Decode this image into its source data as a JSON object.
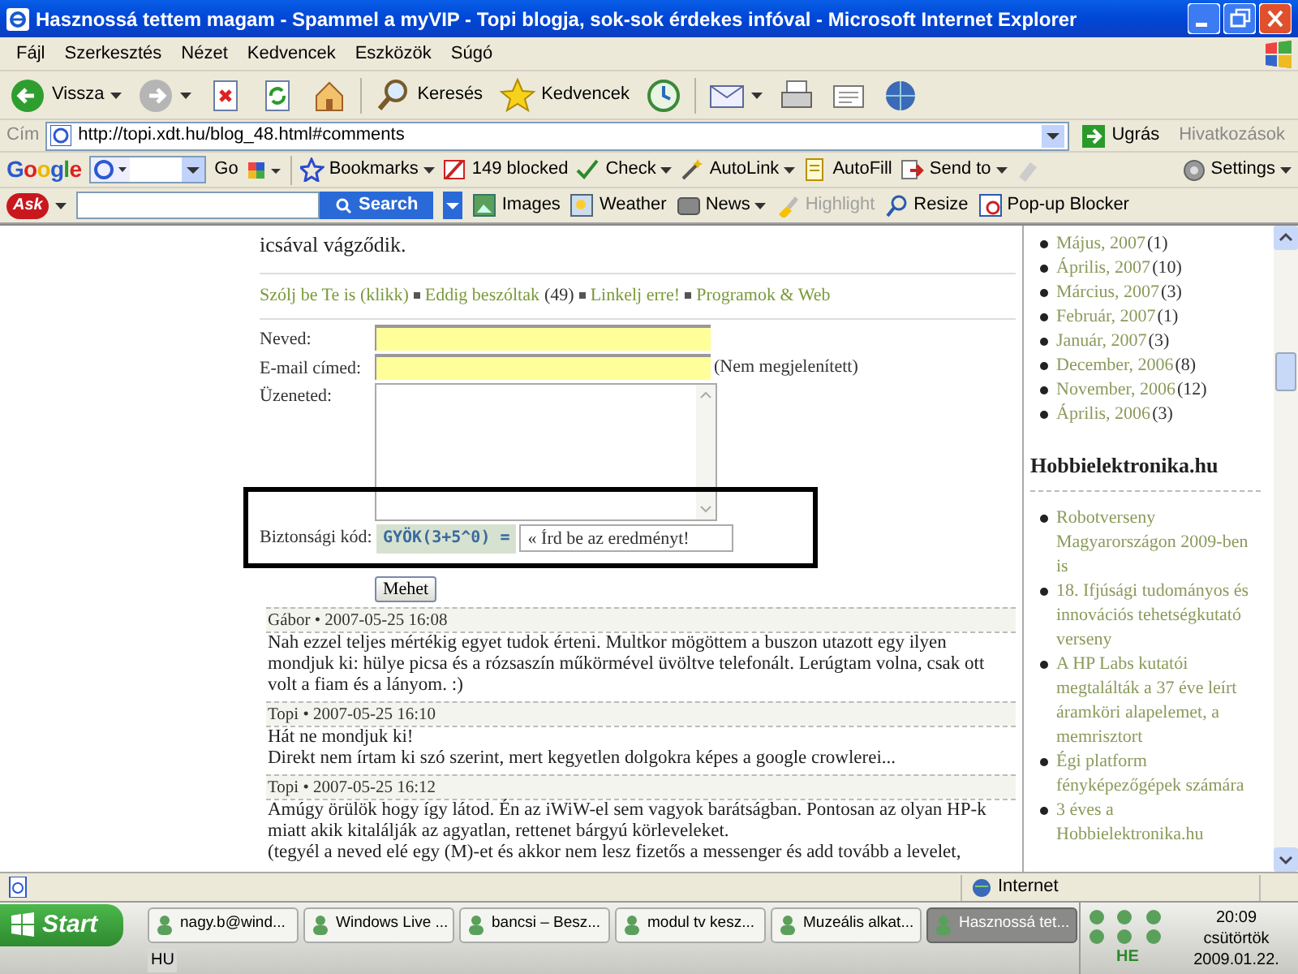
{
  "window": {
    "title": "Hasznossá tettem magam - Spammel a myVIP - Topi blogja, sok-sok érdekes infóval - Microsoft Internet Explorer"
  },
  "menu": [
    "Fájl",
    "Szerkesztés",
    "Nézet",
    "Kedvencek",
    "Eszközök",
    "Súgó"
  ],
  "toolbar": [
    {
      "kind": "back",
      "label": "Vissza"
    },
    {
      "kind": "forward"
    },
    {
      "kind": "stop"
    },
    {
      "kind": "refresh"
    },
    {
      "kind": "home"
    },
    {
      "kind": "search",
      "label": "Keresés"
    },
    {
      "kind": "favorites",
      "label": "Kedvencek"
    },
    {
      "kind": "history"
    },
    {
      "kind": "mail"
    },
    {
      "kind": "print"
    },
    {
      "kind": "edit"
    },
    {
      "kind": "globe"
    }
  ],
  "address": {
    "label": "Cím",
    "url": "http://topi.xdt.hu/blog_48.html#comments",
    "go": "Ugrás",
    "links": "Hivatkozások"
  },
  "google_bar": {
    "logo": "Google",
    "go": "Go",
    "items": [
      {
        "kind": "bookmarks",
        "label": "Bookmarks"
      },
      {
        "kind": "blocked",
        "label": "149 blocked"
      },
      {
        "kind": "check",
        "label": "Check"
      },
      {
        "kind": "autolink",
        "label": "AutoLink"
      },
      {
        "kind": "autofill",
        "label": "AutoFill"
      },
      {
        "kind": "sendto",
        "label": "Send to"
      }
    ],
    "settings": "Settings"
  },
  "ask_bar": {
    "logo": "Ask",
    "search": "Search",
    "items": [
      {
        "kind": "images",
        "label": "Images",
        "disabled": false
      },
      {
        "kind": "weather",
        "label": "Weather",
        "disabled": false
      },
      {
        "kind": "news",
        "label": "News",
        "disabled": false
      },
      {
        "kind": "highlight",
        "label": "Highlight",
        "disabled": true
      },
      {
        "kind": "resize",
        "label": "Resize",
        "disabled": false
      },
      {
        "kind": "popup",
        "label": "Pop-up Blocker",
        "disabled": false
      }
    ]
  },
  "article": {
    "tail": "icsával vágződik.",
    "links": [
      {
        "text": "Szólj be Te is (klikk)"
      },
      {
        "text": "Eddig beszóltak",
        "count": "(49)"
      },
      {
        "text": "Linkelj erre!"
      },
      {
        "text": "Programok & Web"
      }
    ]
  },
  "form": {
    "name_label": "Neved:",
    "email_label": "E-mail címed:",
    "email_note": "(Nem megjelenített)",
    "message_label": "Üzeneted:",
    "captcha_label": "Biztonsági kód:",
    "captcha": "GYÖK(3+5^0) =",
    "captcha_value": "« Írd be az eredményt!",
    "submit": "Mehet"
  },
  "comments": [
    {
      "header": "Gábor • 2007-05-25 16:08",
      "lines": [
        "Nah ezzel teljes mértékig egyet tudok érteni. Multkor mögöttem a buszon utazott egy ilyen mondjuk ki: hülye picsa és a rózsaszín műkörmével üvöltve telefonált. Lerúgtam volna, csak ott volt a fiam és a lányom. :)"
      ]
    },
    {
      "header": "Topi • 2007-05-25 16:10",
      "lines": [
        "Hát ne mondjuk ki!",
        "Direkt nem írtam ki szó szerint, mert kegyetlen dolgokra képes a google crowlerei..."
      ]
    },
    {
      "header": "Topi • 2007-05-25 16:12",
      "lines": [
        "Amúgy örülök hogy így látod. Én az iWiW-el sem vagyok barátságban. Pontosan az olyan HP-k miatt akik kitalálják az agyatlan, rettenet bárgyú körleveleket.",
        "(tegyél a neved elé egy (M)-et és akkor nem lesz fizetős a messenger és add tovább a levelet,"
      ]
    }
  ],
  "sidebar": {
    "archive": [
      {
        "text": "Május, 2007",
        "count": "(1)"
      },
      {
        "text": "Április, 2007",
        "count": "(10)"
      },
      {
        "text": "Március, 2007",
        "count": "(3)"
      },
      {
        "text": "Február, 2007",
        "count": "(1)"
      },
      {
        "text": "Január, 2007",
        "count": "(3)"
      },
      {
        "text": "December, 2006",
        "count": "(8)"
      },
      {
        "text": "November, 2006",
        "count": "(12)"
      },
      {
        "text": "Április, 2006",
        "count": "(3)"
      }
    ],
    "title": "Hobbielektronika.hu",
    "links": [
      "Robotverseny Magyarországon 2009-ben is",
      "18. Ifjúsági tudományos és innovációs tehetségkutató verseny",
      "A HP Labs kutatói megtalálták a 37 éve leírt áramköri alapelemet, a memrisztort",
      "Égi platform fényképezőgépek számára",
      "3 éves a Hobbielektronika.hu"
    ]
  },
  "status_bar": {
    "zone": "Internet"
  },
  "taskbar": {
    "start": "Start",
    "tasks": [
      {
        "label": "nagy.b@wind...",
        "selected": false
      },
      {
        "label": "Windows Live ...",
        "selected": false
      },
      {
        "label": "bancsi – Besz...",
        "selected": false
      },
      {
        "label": "modul tv kesz...",
        "selected": false
      },
      {
        "label": "Muzeális alkat...",
        "selected": false
      },
      {
        "label": "Hasznossá tet...",
        "selected": true
      }
    ],
    "language": "HU",
    "indicator": "HE",
    "time": "20:09",
    "day": "csütörtök",
    "date": "2009.01.22."
  }
}
